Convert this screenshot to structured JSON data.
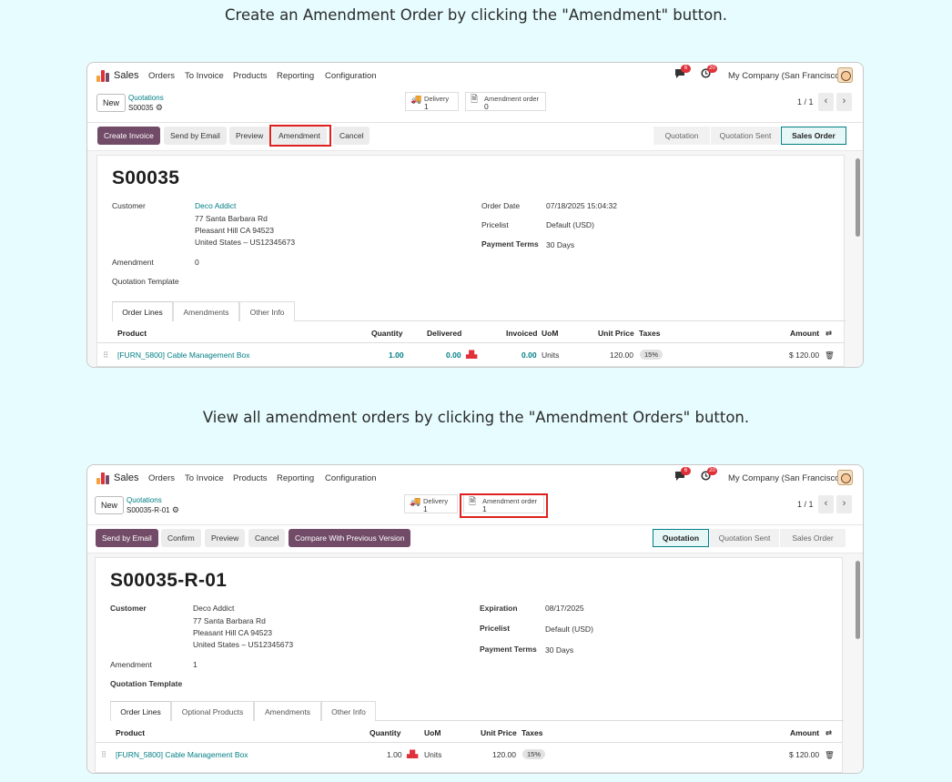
{
  "captions": {
    "first": "Create an Amendment Order by clicking the \"Amendment\" button.",
    "second": "View all amendment orders by clicking the \"Amendment Orders\" button."
  },
  "colors": {
    "brand": "#714b67",
    "accent": "#017e84",
    "highlight": "#e02020",
    "page_bg": "#e6fcfe"
  },
  "nav": {
    "app": "Sales",
    "menu": [
      "Orders",
      "To Invoice",
      "Products",
      "Reporting",
      "Configuration"
    ],
    "company": "My Company (San Francisco)",
    "messages_badge": "6",
    "activity_badge": "20"
  },
  "shot1": {
    "new_label": "New",
    "breadcrumb_parent": "Quotations",
    "breadcrumb_current": "S00035",
    "delivery_label": "Delivery",
    "delivery_count": "1",
    "amend_label": "Amendment order",
    "amend_count": "0",
    "pager": "1 / 1",
    "actions": [
      "Create Invoice",
      "Send by Email",
      "Preview",
      "Amendment",
      "Cancel"
    ],
    "stages": [
      "Quotation",
      "Quotation Sent",
      "Sales Order"
    ],
    "title": "S00035",
    "customer_label": "Customer",
    "customer_name": "Deco Addict",
    "address": [
      "77 Santa Barbara Rd",
      "Pleasant Hill CA 94523",
      "United States – US12345673"
    ],
    "amendment_label": "Amendment",
    "amendment_value": "0",
    "template_label": "Quotation Template",
    "date_label": "Order Date",
    "date_value": "07/18/2025 15:04:32",
    "pricelist_label": "Pricelist",
    "pricelist_value": "Default (USD)",
    "terms_label": "Payment Terms",
    "terms_value": "30 Days",
    "tabs": [
      "Order Lines",
      "Amendments",
      "Other Info"
    ],
    "columns": [
      "Product",
      "Quantity",
      "Delivered",
      "Invoiced",
      "UoM",
      "Unit Price",
      "Taxes",
      "Amount"
    ],
    "row": {
      "product": "[FURN_5800] Cable Management Box",
      "quantity": "1.00",
      "delivered": "0.00",
      "invoiced": "0.00",
      "uom": "Units",
      "unit_price": "120.00",
      "taxes": "15%",
      "amount": "$ 120.00"
    }
  },
  "shot2": {
    "new_label": "New",
    "breadcrumb_parent": "Quotations",
    "breadcrumb_current": "S00035-R-01",
    "delivery_label": "Delivery",
    "delivery_count": "1",
    "amend_label": "Amendment order",
    "amend_count": "1",
    "pager": "1 / 1",
    "actions": [
      "Send by Email",
      "Confirm",
      "Preview",
      "Cancel",
      "Compare With Previous Version"
    ],
    "stages": [
      "Quotation",
      "Quotation Sent",
      "Sales Order"
    ],
    "title": "S00035-R-01",
    "customer_label": "Customer",
    "customer_name": "Deco Addict",
    "address": [
      "77 Santa Barbara Rd",
      "Pleasant Hill CA 94523",
      "United States – US12345673"
    ],
    "amendment_label": "Amendment",
    "amendment_value": "1",
    "template_label": "Quotation Template",
    "date_label": "Expiration",
    "date_value": "08/17/2025",
    "pricelist_label": "Pricelist",
    "pricelist_value": "Default (USD)",
    "terms_label": "Payment Terms",
    "terms_value": "30 Days",
    "tabs": [
      "Order Lines",
      "Optional Products",
      "Amendments",
      "Other Info"
    ],
    "columns": [
      "Product",
      "Quantity",
      "UoM",
      "Unit Price",
      "Taxes",
      "Amount"
    ],
    "row": {
      "product": "[FURN_5800] Cable Management Box",
      "quantity": "1.00",
      "uom": "Units",
      "unit_price": "120.00",
      "taxes": "15%",
      "amount": "$ 120.00"
    }
  }
}
